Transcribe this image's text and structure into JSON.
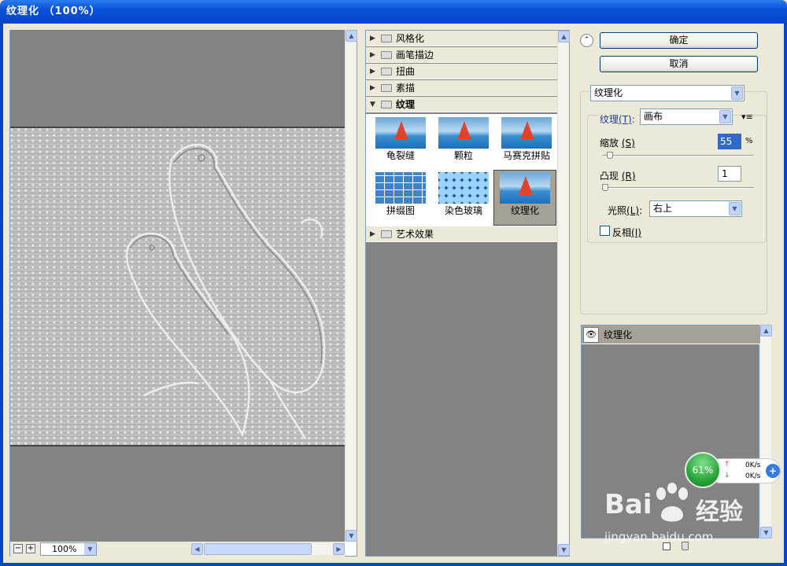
{
  "window": {
    "title": "纹理化 （100%）"
  },
  "preview": {
    "zoom": "100%",
    "zoom_out": "−",
    "zoom_in": "+"
  },
  "filter_tree": {
    "categories": [
      {
        "label": "风格化",
        "expanded": false
      },
      {
        "label": "画笔描边",
        "expanded": false
      },
      {
        "label": "扭曲",
        "expanded": false
      },
      {
        "label": "素描",
        "expanded": false
      },
      {
        "label": "纹理",
        "expanded": true
      },
      {
        "label": "艺术效果",
        "expanded": false
      }
    ],
    "filters": [
      {
        "label": "龟裂缝"
      },
      {
        "label": "颗粒"
      },
      {
        "label": "马赛克拼贴"
      },
      {
        "label": "拼缀图"
      },
      {
        "label": "染色玻璃"
      },
      {
        "label": "纹理化",
        "selected": true
      }
    ]
  },
  "buttons": {
    "ok": "确定",
    "cancel": "取消"
  },
  "filter_select": {
    "value": "纹理化"
  },
  "settings": {
    "texture": {
      "label": "纹理",
      "shortcut": "(T)",
      "colon": ":",
      "value": "画布"
    },
    "scaling": {
      "label": "缩放",
      "shortcut": "(S)",
      "value": "55",
      "unit": "%"
    },
    "relief": {
      "label": "凸现",
      "shortcut": "(R)",
      "value": "1"
    },
    "light": {
      "label": "光照",
      "shortcut": "(L)",
      "colon": ":",
      "value": "右上"
    },
    "invert": {
      "label": "反相",
      "shortcut": "(I)",
      "checked": false
    }
  },
  "layers": [
    {
      "label": "纹理化",
      "visible": true
    }
  ],
  "net_widget": {
    "percent": "61%",
    "upload": "0K/s",
    "download": "0K/s"
  },
  "watermark": {
    "brand": "Bai",
    "brand2": "经验",
    "url": "jingyan.baidu.com"
  },
  "colors": {
    "title_blue": "#0a50d8",
    "canvas_gray": "#838383",
    "selected": "#a5a195"
  }
}
